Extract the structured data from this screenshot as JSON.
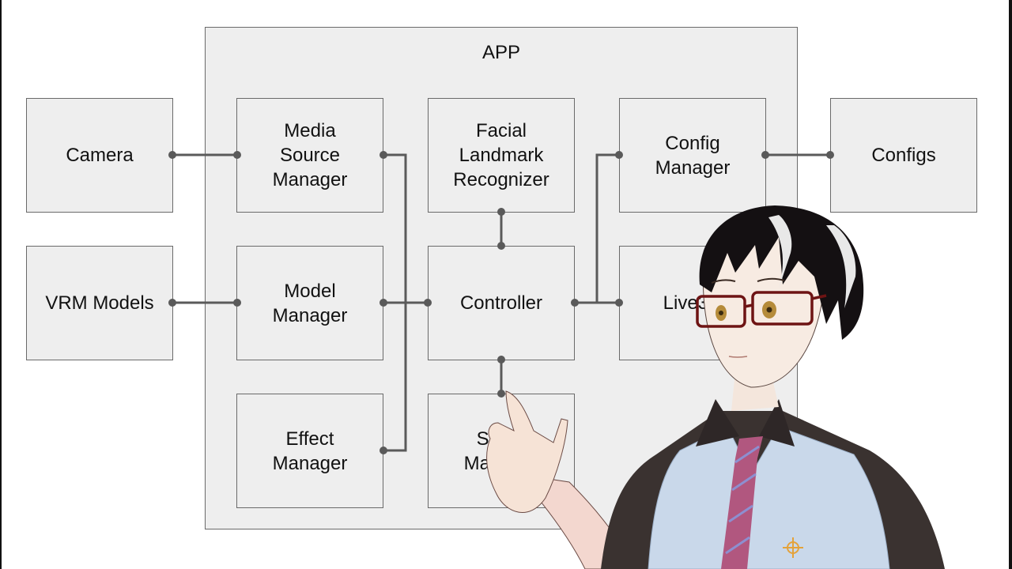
{
  "diagram": {
    "container": {
      "title": "APP"
    },
    "external_nodes": [
      {
        "id": "camera",
        "label": "Camera"
      },
      {
        "id": "vrm-models",
        "label": "VRM Models"
      },
      {
        "id": "configs",
        "label": "Configs"
      }
    ],
    "app_nodes": [
      {
        "id": "media-source-manager",
        "label": "Media\nSource\nManager"
      },
      {
        "id": "facial-landmark-recognizer",
        "label": "Facial\nLandmark\nRecognizer"
      },
      {
        "id": "config-manager",
        "label": "Config\nManager"
      },
      {
        "id": "model-manager",
        "label": "Model\nManager"
      },
      {
        "id": "controller",
        "label": "Controller"
      },
      {
        "id": "live3d",
        "label": "Live3D"
      },
      {
        "id": "effect-manager",
        "label": "Effect\nManager"
      },
      {
        "id": "stage-manager",
        "label": "Stage\nManager"
      }
    ],
    "edges": [
      {
        "from": "camera",
        "to": "media-source-manager"
      },
      {
        "from": "vrm-models",
        "to": "model-manager"
      },
      {
        "from": "config-manager",
        "to": "configs"
      },
      {
        "from": "media-source-manager",
        "to": "controller"
      },
      {
        "from": "model-manager",
        "to": "controller"
      },
      {
        "from": "effect-manager",
        "to": "controller"
      },
      {
        "from": "facial-landmark-recognizer",
        "to": "controller"
      },
      {
        "from": "controller",
        "to": "stage-manager"
      },
      {
        "from": "controller",
        "to": "live3d"
      },
      {
        "from": "controller",
        "to": "config-manager"
      }
    ],
    "colors": {
      "box_fill": "#eeeeee",
      "box_border": "#6a6a6a",
      "connector": "#5a5a5a",
      "text": "#111111"
    }
  },
  "overlay": {
    "character": "vtuber-avatar-with-glasses-pointing"
  }
}
